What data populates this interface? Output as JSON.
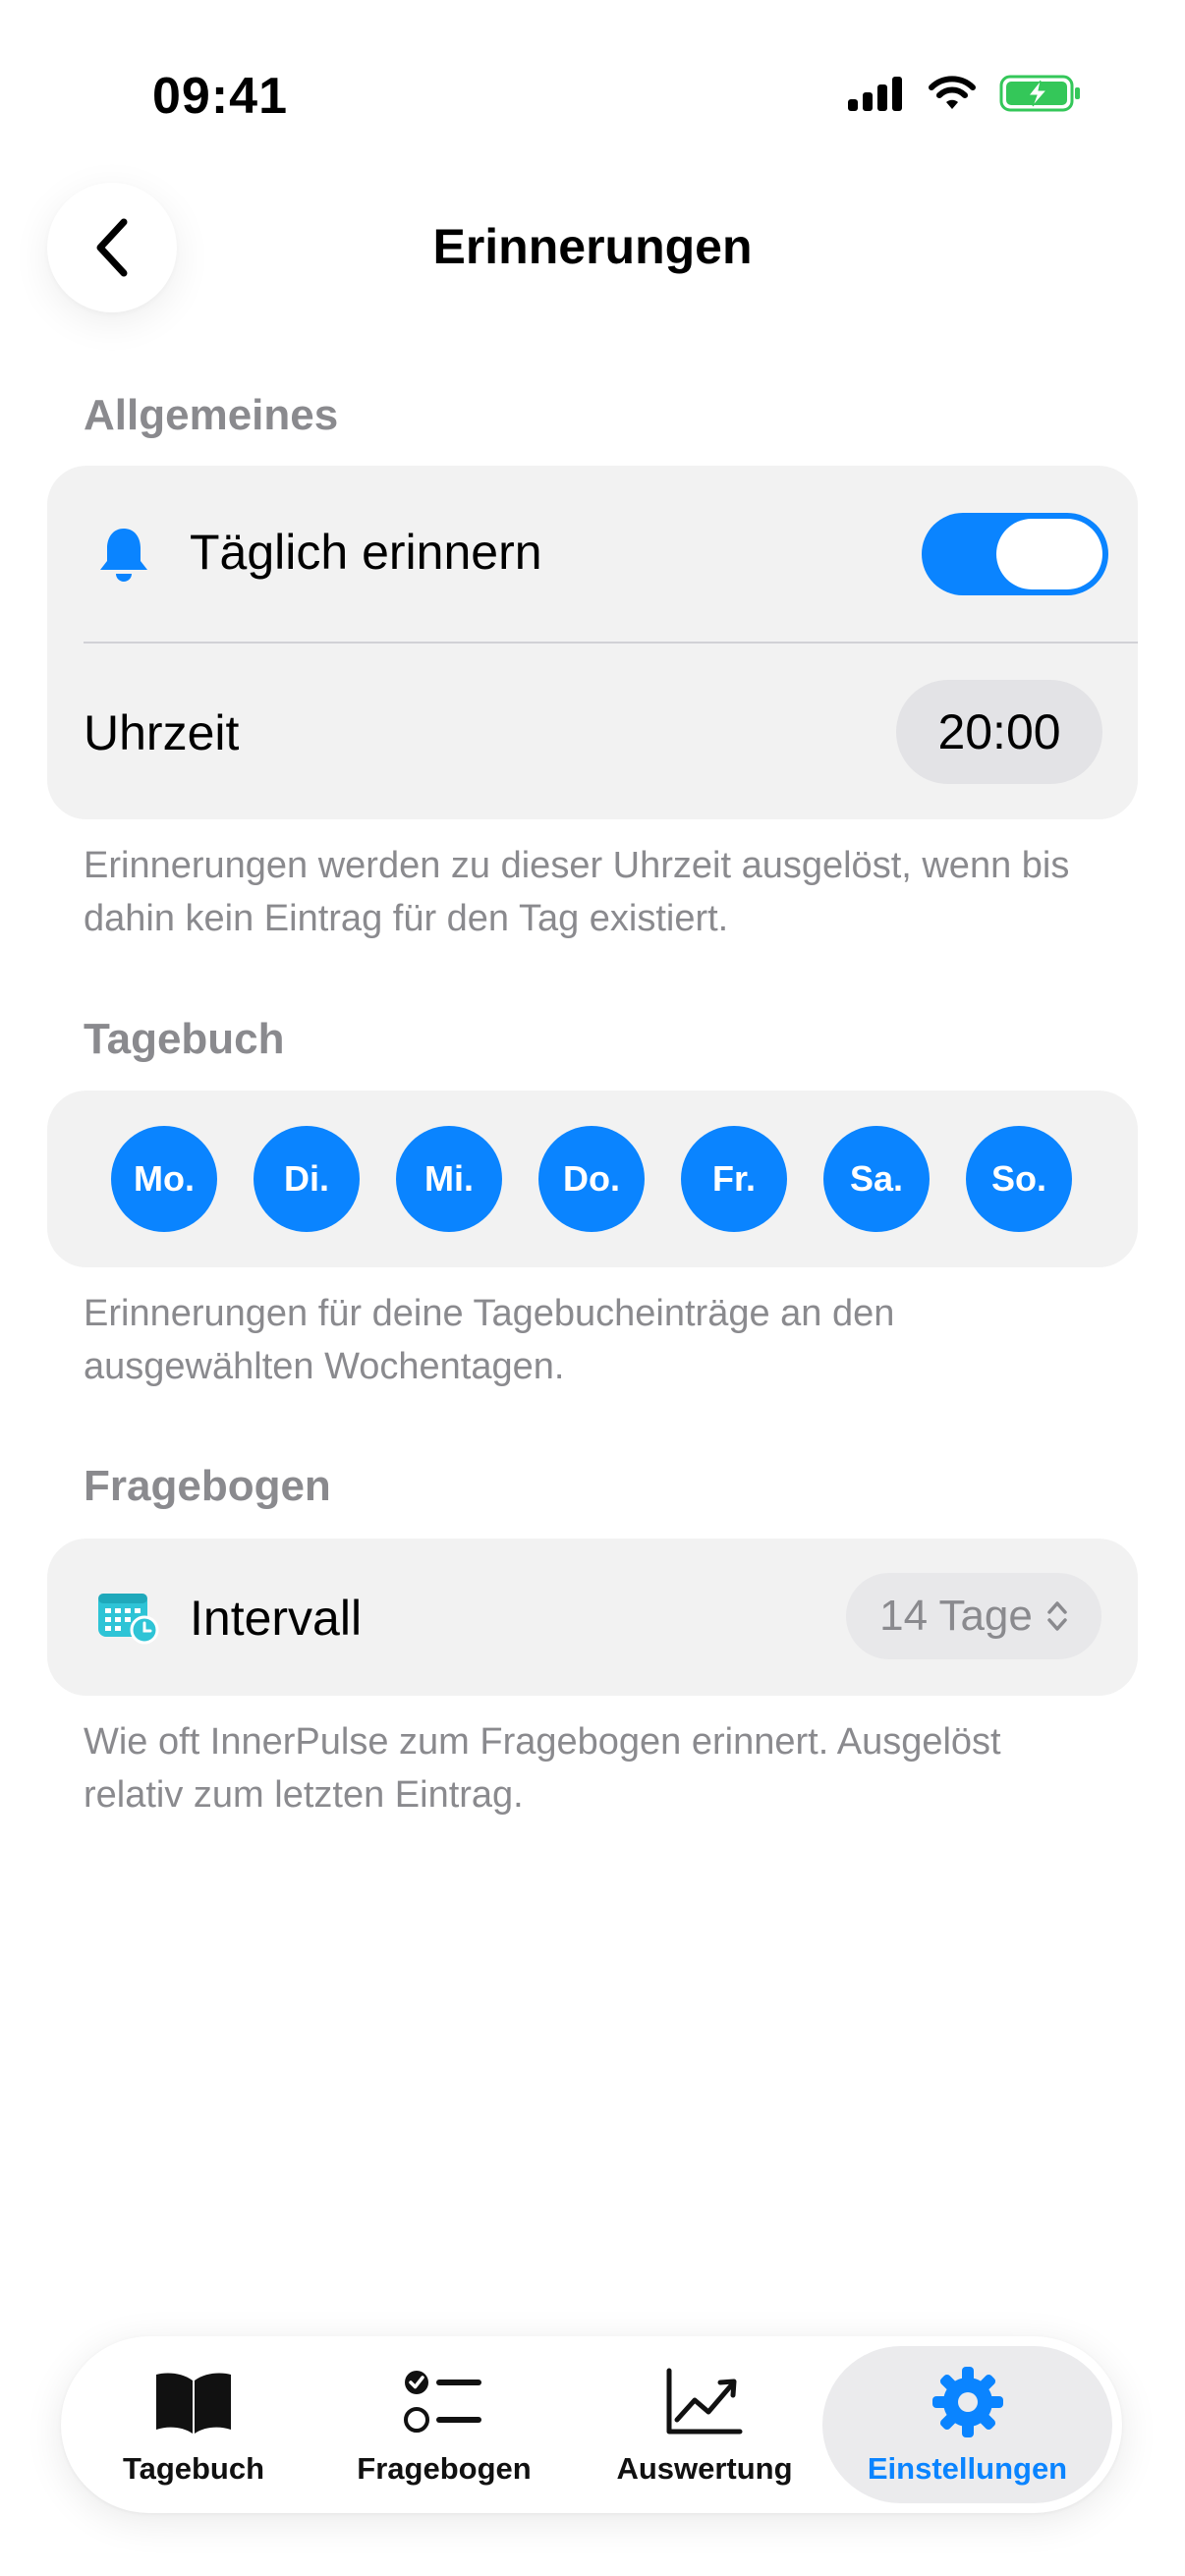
{
  "status_bar": {
    "time": "09:41"
  },
  "nav": {
    "title": "Erinnerungen"
  },
  "sections": {
    "general": {
      "header": "Allgemeines",
      "daily_reminder_label": "Täglich erinnern",
      "daily_reminder_on": true,
      "time_label": "Uhrzeit",
      "time_value": "20:00",
      "footnote": "Erinnerungen werden zu dieser Uhrzeit ausgelöst, wenn bis dahin kein Eintrag für den Tag existiert."
    },
    "diary": {
      "header": "Tagebuch",
      "days": [
        "Mo.",
        "Di.",
        "Mi.",
        "Do.",
        "Fr.",
        "Sa.",
        "So."
      ],
      "footnote": "Erinnerungen für deine Tagebucheinträge an den ausgewählten Wochentagen."
    },
    "questionnaire": {
      "header": "Fragebogen",
      "interval_label": "Intervall",
      "interval_value": "14 Tage",
      "footnote": "Wie oft InnerPulse zum Fragebogen erinnert. Ausgelöst relativ zum letzten Eintrag."
    }
  },
  "tab_bar": {
    "tabs": [
      {
        "label": "Tagebuch",
        "icon": "book-icon"
      },
      {
        "label": "Fragebogen",
        "icon": "checklist-icon"
      },
      {
        "label": "Auswertung",
        "icon": "chart-trend-icon"
      },
      {
        "label": "Einstellungen",
        "icon": "gear-icon"
      }
    ],
    "active": "Einstellungen"
  },
  "colors": {
    "accent": "#0a84ff",
    "card_bg": "#f2f2f2",
    "secondary_text": "#8a8a8e",
    "battery_green": "#34c759",
    "calendar_teal": "#2ec4d6"
  }
}
